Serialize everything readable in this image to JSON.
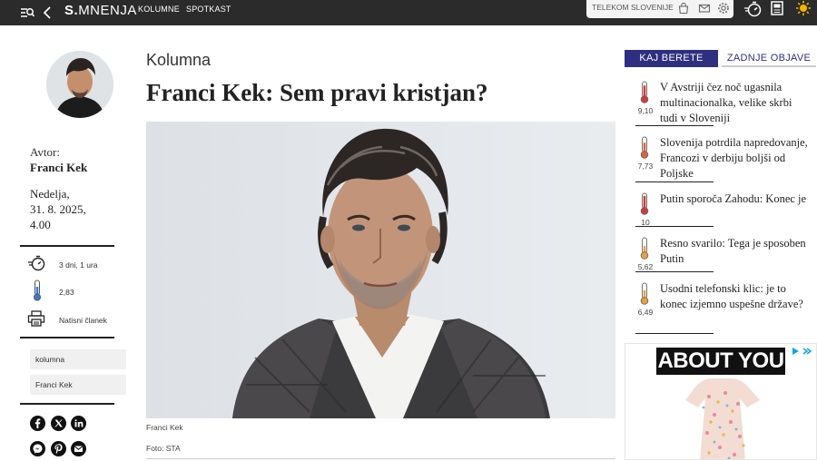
{
  "topbar": {
    "logo_bold": "S.",
    "logo_rest": "MNENJA",
    "nav": [
      "KOLUMNE",
      "SPOTKAST"
    ],
    "telekom_label": "TELEKOM SLOVENIJE"
  },
  "article": {
    "kicker": "Kolumna",
    "headline": "Franci Kek: Sem pravi kristjan?",
    "caption": "Franci Kek",
    "photo_credit": "Foto: STA"
  },
  "meta": {
    "author_label": "Avtor:",
    "author_name": "Franci Kek",
    "date_line1": "Nedelja,",
    "date_line2": "31. 8. 2025,",
    "date_line3": "4.00",
    "age": "3 dni, 1 ura",
    "temperature": "2,83",
    "print_label": "Natisni članek",
    "tags": [
      "kolumna",
      "Franci Kek"
    ]
  },
  "sidebar": {
    "tab_active": "KAJ BERETE",
    "tab_inactive": "ZADNJE OBJAVE",
    "items": [
      {
        "title": "V Avstriji čez noč ugasnila multinacionalka, velike skrbi tudi v Sloveniji",
        "score": "9,10",
        "color": "#d23a3a",
        "level": 0.91
      },
      {
        "title": "Slovenija potrdila napredovanje, Francozi v derbiju boljši od Poljske",
        "score": "7,73",
        "color": "#e0603a",
        "level": 0.77
      },
      {
        "title": "Putin sporoča Zahodu: Konec je",
        "score": "10",
        "color": "#d23a3a",
        "level": 1.0
      },
      {
        "title": "Resno svarilo: Tega je sposoben Putin",
        "score": "5,62",
        "color": "#e8a23a",
        "level": 0.56
      },
      {
        "title": "Usodni telefonski klic: je to konec izjemno uspešne države?",
        "score": "6,49",
        "color": "#e8a23a",
        "level": 0.65
      }
    ]
  },
  "ad": {
    "brand": "ABOUT YOU"
  },
  "colors": {
    "accent": "#2f2f80",
    "topbar": "#2b2b2b"
  }
}
